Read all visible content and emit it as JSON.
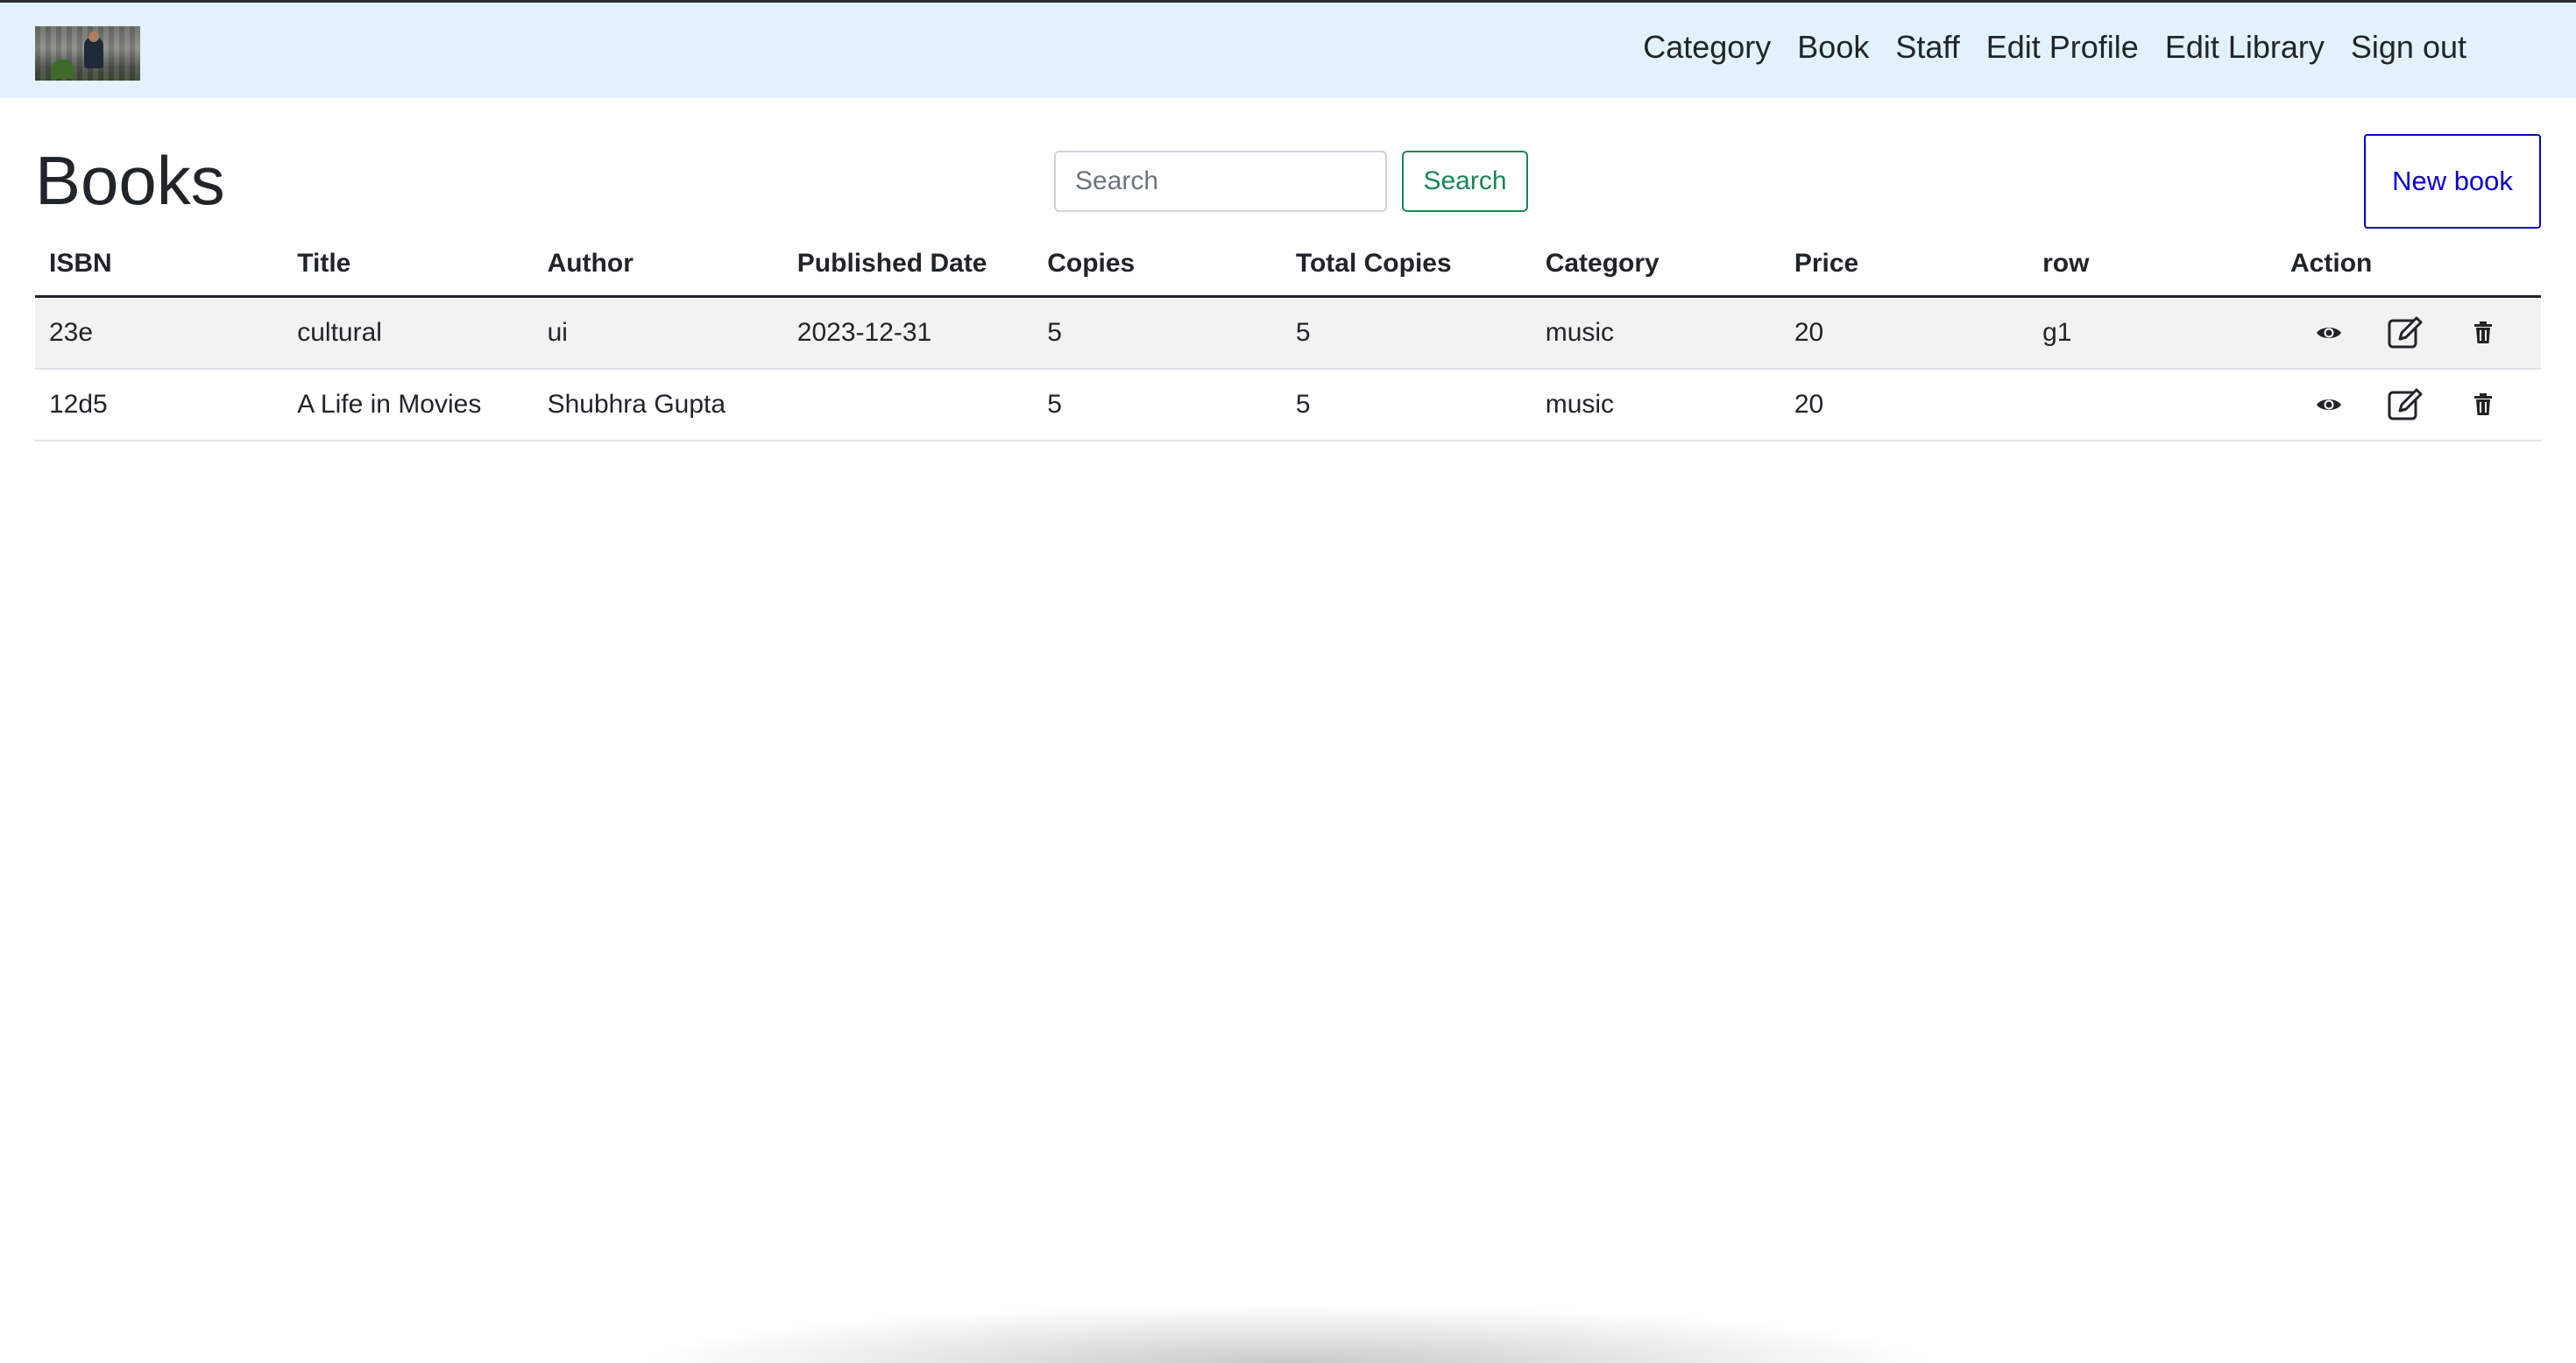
{
  "navbar": {
    "logo_alt": "Library logo",
    "links": [
      {
        "label": "Category"
      },
      {
        "label": "Book"
      },
      {
        "label": "Staff"
      },
      {
        "label": "Edit Profile"
      },
      {
        "label": "Edit Library"
      },
      {
        "label": "Sign out"
      }
    ]
  },
  "page": {
    "title": "Books"
  },
  "search": {
    "placeholder": "Search",
    "value": "",
    "button_label": "Search"
  },
  "new_book": {
    "label": "New book"
  },
  "table": {
    "columns": [
      "ISBN",
      "Title",
      "Author",
      "Published Date",
      "Copies",
      "Total Copies",
      "Category",
      "Price",
      "row",
      "Action"
    ],
    "rows": [
      {
        "isbn": "23e",
        "title": "cultural",
        "author": "ui",
        "published_date": "2023-12-31",
        "copies": "5",
        "total_copies": "5",
        "category": "music",
        "price": "20",
        "row": "g1",
        "actions": [
          "eye-icon",
          "edit-icon",
          "trash-icon"
        ]
      },
      {
        "isbn": "12d5",
        "title": "A Life in Movies",
        "author": "Shubhra Gupta",
        "published_date": "",
        "copies": "5",
        "total_copies": "5",
        "category": "music",
        "price": "20",
        "row": "",
        "actions": [
          "eye-icon",
          "edit-icon",
          "trash-icon"
        ]
      }
    ]
  },
  "colors": {
    "navbar_bg": "#e3f1fc",
    "search_button": "#198754",
    "new_book_button": "#0d00cc",
    "row_stripe": "#f2f2f2"
  }
}
